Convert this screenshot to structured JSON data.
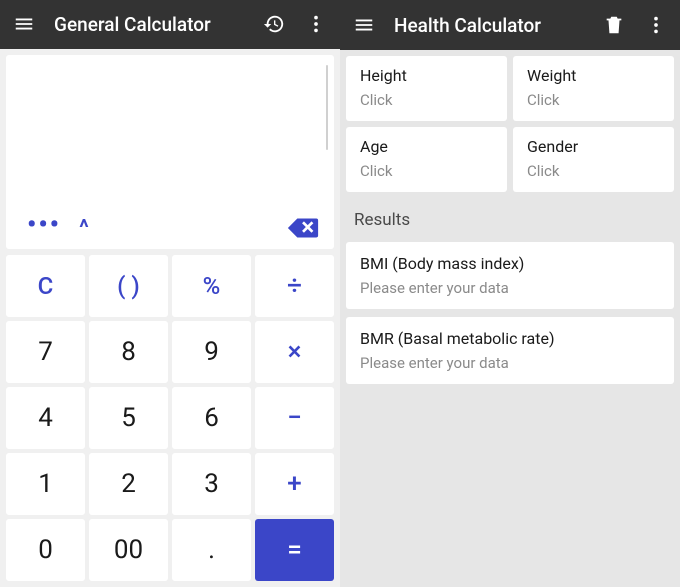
{
  "left": {
    "title": "General Calculator",
    "toolbar_icons": {
      "history": "history-icon",
      "more": "more-icon"
    },
    "display": {
      "value": "",
      "ellipsis": "•••",
      "caret": "^"
    },
    "keys": {
      "clear": "C",
      "paren": "( )",
      "percent": "%",
      "divide": "÷",
      "k7": "7",
      "k8": "8",
      "k9": "9",
      "multiply": "×",
      "k4": "4",
      "k5": "5",
      "k6": "6",
      "minus": "−",
      "k1": "1",
      "k2": "2",
      "k3": "3",
      "plus": "+",
      "k0": "0",
      "k00": "00",
      "dot": ".",
      "equals": "="
    }
  },
  "right": {
    "title": "Health Calculator",
    "toolbar_icons": {
      "delete": "trash-icon",
      "more": "more-icon"
    },
    "inputs": {
      "height": {
        "label": "Height",
        "value": "Click"
      },
      "weight": {
        "label": "Weight",
        "value": "Click"
      },
      "age": {
        "label": "Age",
        "value": "Click"
      },
      "gender": {
        "label": "Gender",
        "value": "Click"
      }
    },
    "results_title": "Results",
    "results": {
      "bmi": {
        "label": "BMI (Body mass index)",
        "hint": "Please enter your data"
      },
      "bmr": {
        "label": "BMR (Basal metabolic rate)",
        "hint": "Please enter your data"
      }
    }
  },
  "colors": {
    "accent": "#3b46c8",
    "appbar": "#333333"
  }
}
